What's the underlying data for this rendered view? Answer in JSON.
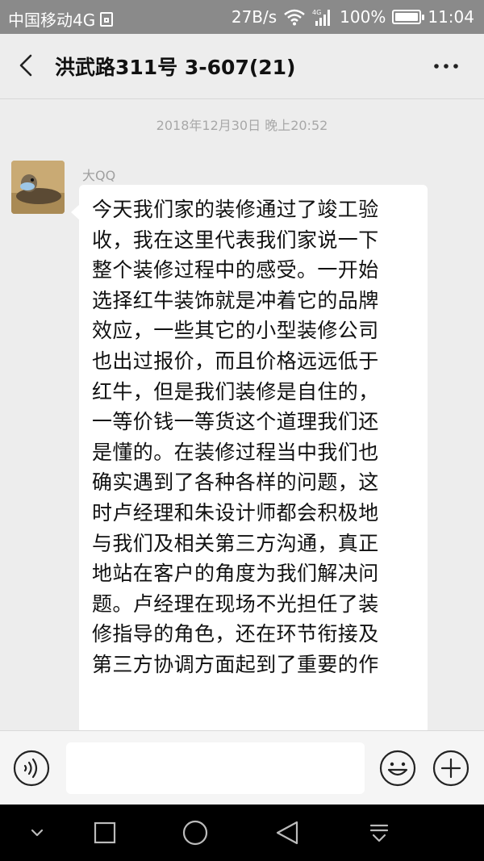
{
  "status_bar": {
    "carrier": "中国移动4G",
    "speed": "27B/s",
    "network": "4G",
    "battery": "100%",
    "battery_level": 1.0,
    "time": "11:04"
  },
  "header": {
    "title": "洪武路311号 3-607(21)",
    "back_icon": "back-arrow-icon",
    "more_icon": "more-dots-icon"
  },
  "chat": {
    "timestamp": "2018年12月30日 晚上20:52",
    "message": {
      "sender": "大QQ",
      "lines": [
        "今天我们家的装修通过了竣工验",
        "收，我在这里代表我们家说一下",
        "整个装修过程中的感受。一开始",
        "选择红牛装饰就是冲着它的品牌",
        "效应，一些其它的小型装修公司",
        "也出过报价，而且价格远远低于",
        "红牛，但是我们装修是自住的，",
        "一等价钱一等货这个道理我们还",
        "是懂的。在装修过程当中我们也",
        "确实遇到了各种各样的问题，这",
        "时卢经理和朱设计师都会积极地",
        "与我们及相关第三方沟通，真正",
        "地站在客户的角度为我们解决问",
        "题。卢经理在现场不光担任了装",
        "修指导的角色，还在环节衔接及",
        "第三方协调方面起到了重要的作"
      ]
    }
  },
  "input_bar": {
    "voice_icon": "voice-icon",
    "emoji_icon": "emoji-icon",
    "plus_icon": "plus-icon",
    "input_value": ""
  },
  "nav_bar": {
    "icons": [
      "collapse-icon",
      "square-icon",
      "circle-icon",
      "triangle-back-icon",
      "notification-pull-icon"
    ]
  },
  "colors": {
    "status_bar_bg": "#8a8a8a",
    "chat_bg": "#ededed",
    "bubble_bg": "#ffffff",
    "nav_bar_bg": "#000000"
  }
}
